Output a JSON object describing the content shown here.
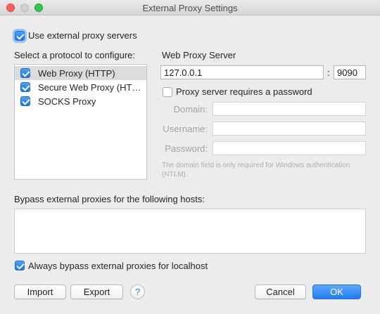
{
  "window": {
    "title": "External Proxy Settings"
  },
  "use_external": {
    "label": "Use external proxy servers",
    "checked": true
  },
  "protocols": {
    "heading": "Select a protocol to configure:",
    "items": [
      {
        "label": "Web Proxy (HTTP)",
        "checked": true,
        "selected": true
      },
      {
        "label": "Secure Web Proxy (HT…",
        "checked": true,
        "selected": false
      },
      {
        "label": "SOCKS Proxy",
        "checked": true,
        "selected": false
      }
    ]
  },
  "server": {
    "heading": "Web Proxy Server",
    "host": "127.0.0.1",
    "separator": ":",
    "port": "9090",
    "password_required": {
      "label": "Proxy server requires a password",
      "checked": false
    },
    "domain_label": "Domain:",
    "username_label": "Username:",
    "password_label": "Password:",
    "note": "The domain field is only required for Windows authentication (NTLM)."
  },
  "bypass": {
    "heading": "Bypass external proxies for the following hosts:",
    "hosts": "",
    "localhost": {
      "label": "Always bypass external proxies for localhost",
      "checked": true
    }
  },
  "buttons": {
    "import": "Import",
    "export": "Export",
    "help": "?",
    "cancel": "Cancel",
    "ok": "OK"
  },
  "colors": {
    "accent": "#1f7cf2",
    "selection": "#dcdcdc",
    "window": "#ececec"
  }
}
